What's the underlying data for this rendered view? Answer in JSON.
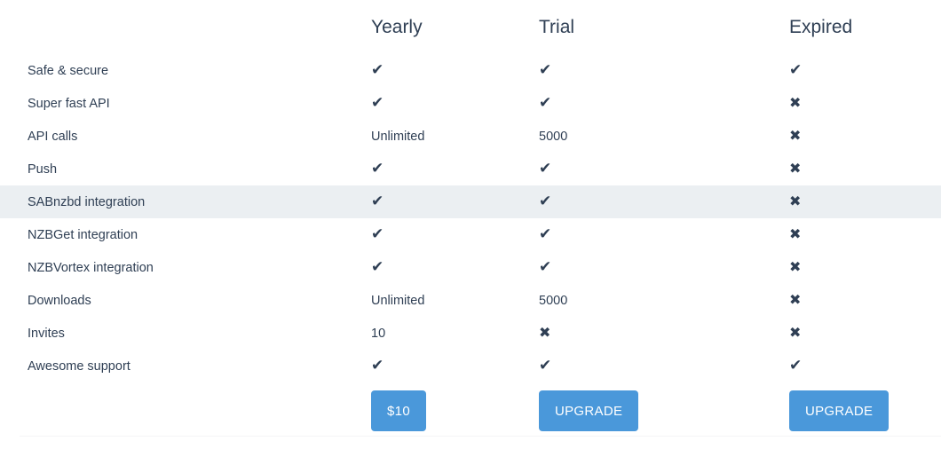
{
  "table": {
    "feature_column_header": "",
    "plans": [
      {
        "name": "Yearly",
        "cta_label": "$10"
      },
      {
        "name": "Trial",
        "cta_label": "UPGRADE"
      },
      {
        "name": "Expired",
        "cta_label": "UPGRADE"
      }
    ],
    "glyphs": {
      "check": "✔",
      "cross": "✖"
    },
    "rows": [
      {
        "feature": "Safe & secure",
        "values": [
          "check",
          "check",
          "check"
        ],
        "highlighted": false
      },
      {
        "feature": "Super fast API",
        "values": [
          "check",
          "check",
          "cross"
        ],
        "highlighted": false
      },
      {
        "feature": "API calls",
        "values": [
          "Unlimited",
          "5000",
          "cross"
        ],
        "highlighted": false
      },
      {
        "feature": "Push",
        "values": [
          "check",
          "check",
          "cross"
        ],
        "highlighted": false
      },
      {
        "feature": "SABnzbd integration",
        "values": [
          "check",
          "check",
          "cross"
        ],
        "highlighted": true
      },
      {
        "feature": "NZBGet integration",
        "values": [
          "check",
          "check",
          "cross"
        ],
        "highlighted": false
      },
      {
        "feature": "NZBVortex integration",
        "values": [
          "check",
          "check",
          "cross"
        ],
        "highlighted": false
      },
      {
        "feature": "Downloads",
        "values": [
          "Unlimited",
          "5000",
          "cross"
        ],
        "highlighted": false
      },
      {
        "feature": "Invites",
        "values": [
          "10",
          "cross",
          "cross"
        ],
        "highlighted": false
      },
      {
        "feature": "Awesome support",
        "values": [
          "check",
          "check",
          "check"
        ],
        "highlighted": false
      }
    ]
  },
  "colors": {
    "text": "#2f3f54",
    "accent_button": "#4a98da",
    "row_highlight": "#ebeff2",
    "background": "#ffffff",
    "bottom_rule": "#f4f5f6"
  }
}
